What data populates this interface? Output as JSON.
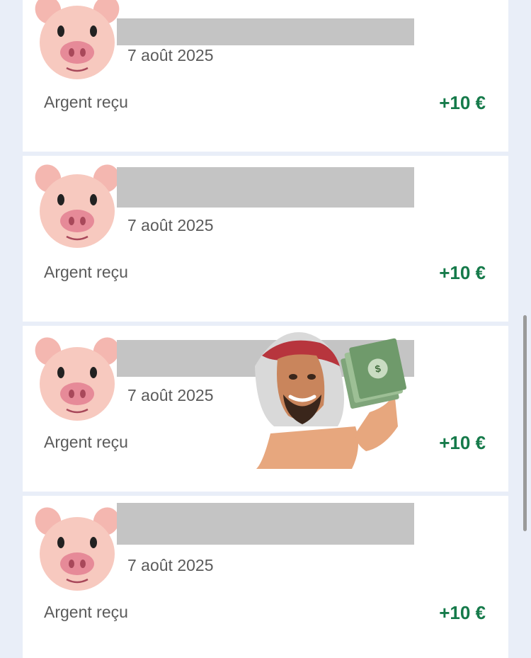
{
  "transactions": [
    {
      "date": "7 août 2025",
      "type": "Argent reçu",
      "amount": "+10 €"
    },
    {
      "date": "7 août 2025",
      "type": "Argent reçu",
      "amount": "+10 €"
    },
    {
      "date": "7 août 2025",
      "type": "Argent reçu",
      "amount": "+10 €"
    },
    {
      "date": "7 août 2025",
      "type": "Argent reçu",
      "amount": "+10 €"
    }
  ],
  "colors": {
    "background": "#e9eef8",
    "card": "#ffffff",
    "amount_green": "#157a4a",
    "redaction": "#c4c4c4"
  },
  "icons": {
    "avatar": "pig-face-icon",
    "sticker": "man-holding-money-sticker"
  }
}
